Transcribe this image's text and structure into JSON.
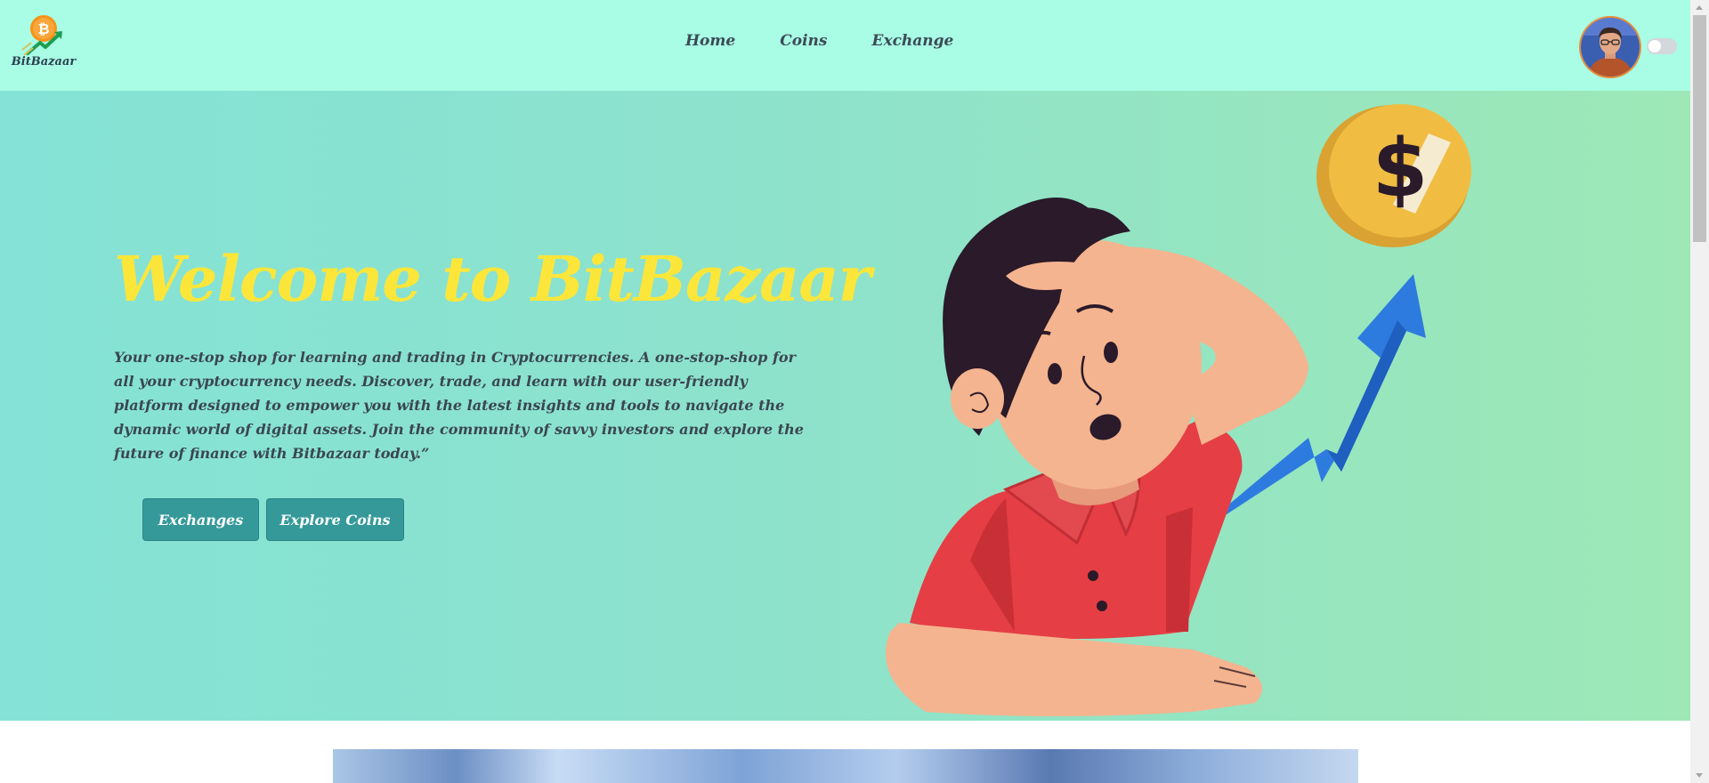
{
  "brand": {
    "name": "BitBazaar",
    "logo_icon": "bitcoin-growth-icon"
  },
  "nav": {
    "links": [
      {
        "label": "Home"
      },
      {
        "label": "Coins"
      },
      {
        "label": "Exchange"
      }
    ]
  },
  "header": {
    "avatar_icon": "user-avatar",
    "theme_toggle_on": false
  },
  "hero": {
    "title": "Welcome to BitBazaar",
    "description": "Your one-stop shop for learning and trading in Cryptocurrencies. A one-stop-shop for all your cryptocurrency needs. Discover, trade, and learn with our user-friendly platform designed to empower you with the latest insights and tools to navigate the dynamic world of digital assets. Join the community of savvy investors and explore the future of finance with Bitbazaar today.”",
    "buttons": {
      "exchanges": "Exchanges",
      "explore_coins": "Explore Coins"
    },
    "illustration_icon": "confused-investor-coin-arrow-illustration"
  },
  "colors": {
    "navbar_bg": "#a8fde4",
    "hero_gradient_start": "#84e3d6",
    "hero_gradient_end": "#9de8b6",
    "title": "#fde63a",
    "button_bg": "#35999a",
    "text": "#3b4652"
  }
}
